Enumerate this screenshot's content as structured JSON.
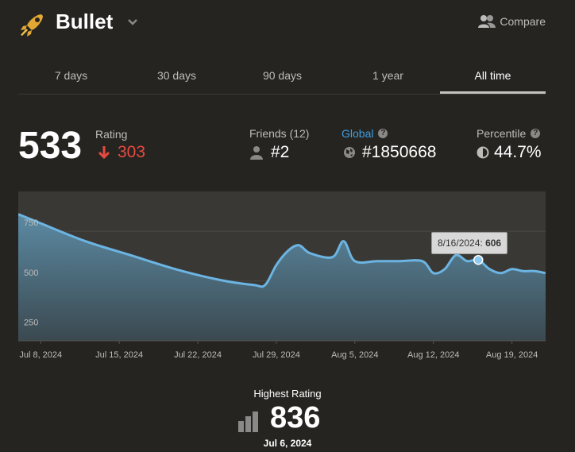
{
  "header": {
    "title": "Bullet",
    "compare_label": "Compare",
    "icons": {
      "logo": "bullet-rocket-icon",
      "chevron": "chevron-down-icon",
      "compare": "people-icon"
    }
  },
  "tabs": [
    "7 days",
    "30 days",
    "90 days",
    "1 year",
    "All time"
  ],
  "active_tab": "All time",
  "stats": {
    "rating": "533",
    "rating_label": "Rating",
    "rating_change": "303",
    "rating_change_direction": "down",
    "friends_label": "Friends (12)",
    "friends_rank": "#2",
    "global_label": "Global",
    "global_rank": "#1850668",
    "percentile_label": "Percentile",
    "percentile": "44.7%"
  },
  "colors": {
    "background": "#262421",
    "accent_blue": "#3e9ee0",
    "negative": "#e64a3f",
    "line": "#6cb4e2"
  },
  "tooltip": {
    "date": "8/16/2024:",
    "value": "606"
  },
  "highest": {
    "label": "Highest Rating",
    "value": "836",
    "date": "Jul 6, 2024"
  },
  "chart_data": {
    "type": "area",
    "x_ticks": [
      "Jul 8, 2024",
      "Jul 15, 2024",
      "Jul 22, 2024",
      "Jul 29, 2024",
      "Aug 5, 2024",
      "Aug 12, 2024",
      "Aug 19, 2024"
    ],
    "y_ticks": [
      "750",
      "500",
      "250"
    ],
    "ylim": [
      200,
      950
    ],
    "xlim": [
      "2024-07-06",
      "2024-08-22"
    ],
    "grid": true,
    "series": [
      {
        "points": [
          [
            "2024-07-06",
            836
          ],
          [
            "2024-07-08",
            790
          ],
          [
            "2024-07-12",
            700
          ],
          [
            "2024-07-16",
            630
          ],
          [
            "2024-07-20",
            560
          ],
          [
            "2024-07-24",
            505
          ],
          [
            "2024-07-27",
            480
          ],
          [
            "2024-07-28",
            480
          ],
          [
            "2024-07-29",
            580
          ],
          [
            "2024-07-30",
            650
          ],
          [
            "2024-07-31",
            680
          ],
          [
            "2024-08-01",
            640
          ],
          [
            "2024-08-03",
            620
          ],
          [
            "2024-08-04",
            700
          ],
          [
            "2024-08-05",
            600
          ],
          [
            "2024-08-07",
            600
          ],
          [
            "2024-08-09",
            600
          ],
          [
            "2024-08-11",
            600
          ],
          [
            "2024-08-12",
            540
          ],
          [
            "2024-08-13",
            560
          ],
          [
            "2024-08-14",
            630
          ],
          [
            "2024-08-15",
            600
          ],
          [
            "2024-08-16",
            606
          ],
          [
            "2024-08-17",
            560
          ],
          [
            "2024-08-18",
            540
          ],
          [
            "2024-08-19",
            560
          ],
          [
            "2024-08-20",
            550
          ],
          [
            "2024-08-21",
            550
          ],
          [
            "2024-08-22",
            540
          ]
        ]
      }
    ],
    "highlight": {
      "date": "2024-08-16",
      "value": 606
    }
  }
}
